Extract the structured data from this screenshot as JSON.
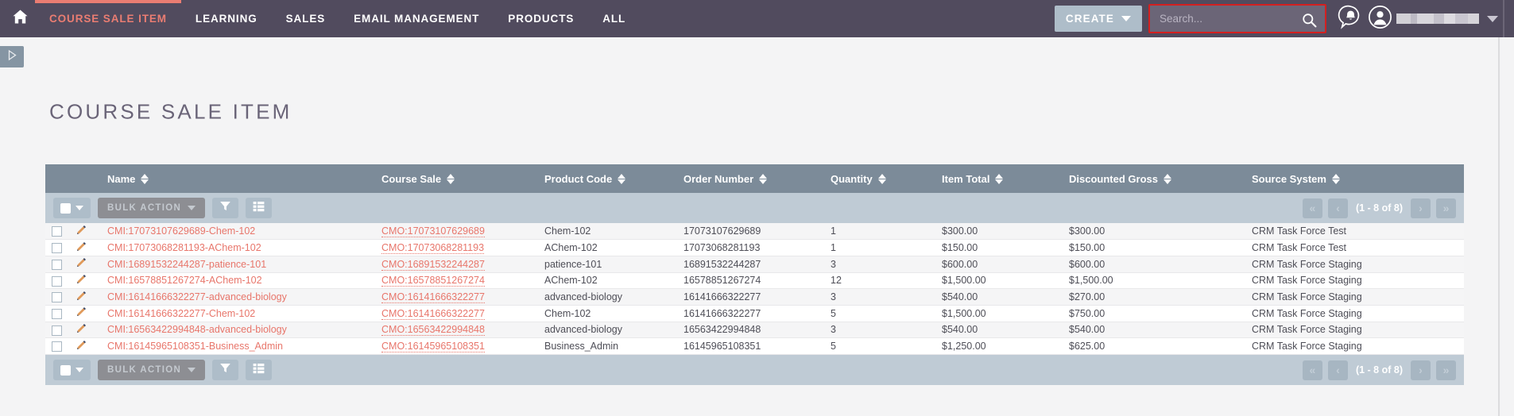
{
  "nav": {
    "home_icon": "home-icon",
    "items": [
      {
        "label": "COURSE SALE ITEM",
        "active": true
      },
      {
        "label": "LEARNING",
        "active": false
      },
      {
        "label": "SALES",
        "active": false
      },
      {
        "label": "EMAIL MANAGEMENT",
        "active": false
      },
      {
        "label": "PRODUCTS",
        "active": false
      },
      {
        "label": "ALL",
        "active": false
      }
    ],
    "create_label": "CREATE",
    "search_placeholder": "Search...",
    "search_value": "",
    "search_icon": "search-icon",
    "bell_icon": "notification-bell-icon",
    "avatar_icon": "user-avatar-icon",
    "username": "",
    "accent_color": "#ea7d72",
    "bar_color": "#514b5e",
    "search_highlight_color": "#d32020"
  },
  "page": {
    "title": "COURSE SALE ITEM",
    "sidebar_toggle_icon": "expand-sidebar-icon"
  },
  "toolbar": {
    "select_all_label": "",
    "bulk_action_label": "BULK ACTION",
    "filter_icon": "filter-funnel-icon",
    "columns_icon": "column-chooser-icon",
    "pagination": {
      "first_label": "«",
      "prev_label": "‹",
      "count_label": "(1 - 8 of 8)",
      "next_label": "›",
      "last_label": "»"
    }
  },
  "table": {
    "columns": [
      {
        "label": "Name"
      },
      {
        "label": "Course Sale"
      },
      {
        "label": "Product Code"
      },
      {
        "label": "Order Number"
      },
      {
        "label": "Quantity"
      },
      {
        "label": "Item Total"
      },
      {
        "label": "Discounted Gross"
      },
      {
        "label": "Source System"
      }
    ],
    "rows": [
      {
        "name": "CMI:17073107629689-Chem-102",
        "course_sale": "CMO:17073107629689",
        "product_code": "Chem-102",
        "order_number": "17073107629689",
        "quantity": "1",
        "item_total": "$300.00",
        "discounted_gross": "$300.00",
        "source_system": "CRM Task Force Test"
      },
      {
        "name": "CMI:17073068281193-AChem-102",
        "course_sale": "CMO:17073068281193",
        "product_code": "AChem-102",
        "order_number": "17073068281193",
        "quantity": "1",
        "item_total": "$150.00",
        "discounted_gross": "$150.00",
        "source_system": "CRM Task Force Test"
      },
      {
        "name": "CMI:16891532244287-patience-101",
        "course_sale": "CMO:16891532244287",
        "product_code": "patience-101",
        "order_number": "16891532244287",
        "quantity": "3",
        "item_total": "$600.00",
        "discounted_gross": "$600.00",
        "source_system": "CRM Task Force Staging"
      },
      {
        "name": "CMI:16578851267274-AChem-102",
        "course_sale": "CMO:16578851267274",
        "product_code": "AChem-102",
        "order_number": "16578851267274",
        "quantity": "12",
        "item_total": "$1,500.00",
        "discounted_gross": "$1,500.00",
        "source_system": "CRM Task Force Staging"
      },
      {
        "name": "CMI:16141666322277-advanced-biology",
        "course_sale": "CMO:16141666322277",
        "product_code": "advanced-biology",
        "order_number": "16141666322277",
        "quantity": "3",
        "item_total": "$540.00",
        "discounted_gross": "$270.00",
        "source_system": "CRM Task Force Staging"
      },
      {
        "name": "CMI:16141666322277-Chem-102",
        "course_sale": "CMO:16141666322277",
        "product_code": "Chem-102",
        "order_number": "16141666322277",
        "quantity": "5",
        "item_total": "$1,500.00",
        "discounted_gross": "$750.00",
        "source_system": "CRM Task Force Staging"
      },
      {
        "name": "CMI:16563422994848-advanced-biology",
        "course_sale": "CMO:16563422994848",
        "product_code": "advanced-biology",
        "order_number": "16563422994848",
        "quantity": "3",
        "item_total": "$540.00",
        "discounted_gross": "$540.00",
        "source_system": "CRM Task Force Staging"
      },
      {
        "name": "CMI:16145965108351-Business_Admin",
        "course_sale": "CMO:16145965108351",
        "product_code": "Business_Admin",
        "order_number": "16145965108351",
        "quantity": "5",
        "item_total": "$1,250.00",
        "discounted_gross": "$625.00",
        "source_system": "CRM Task Force Staging"
      }
    ]
  }
}
